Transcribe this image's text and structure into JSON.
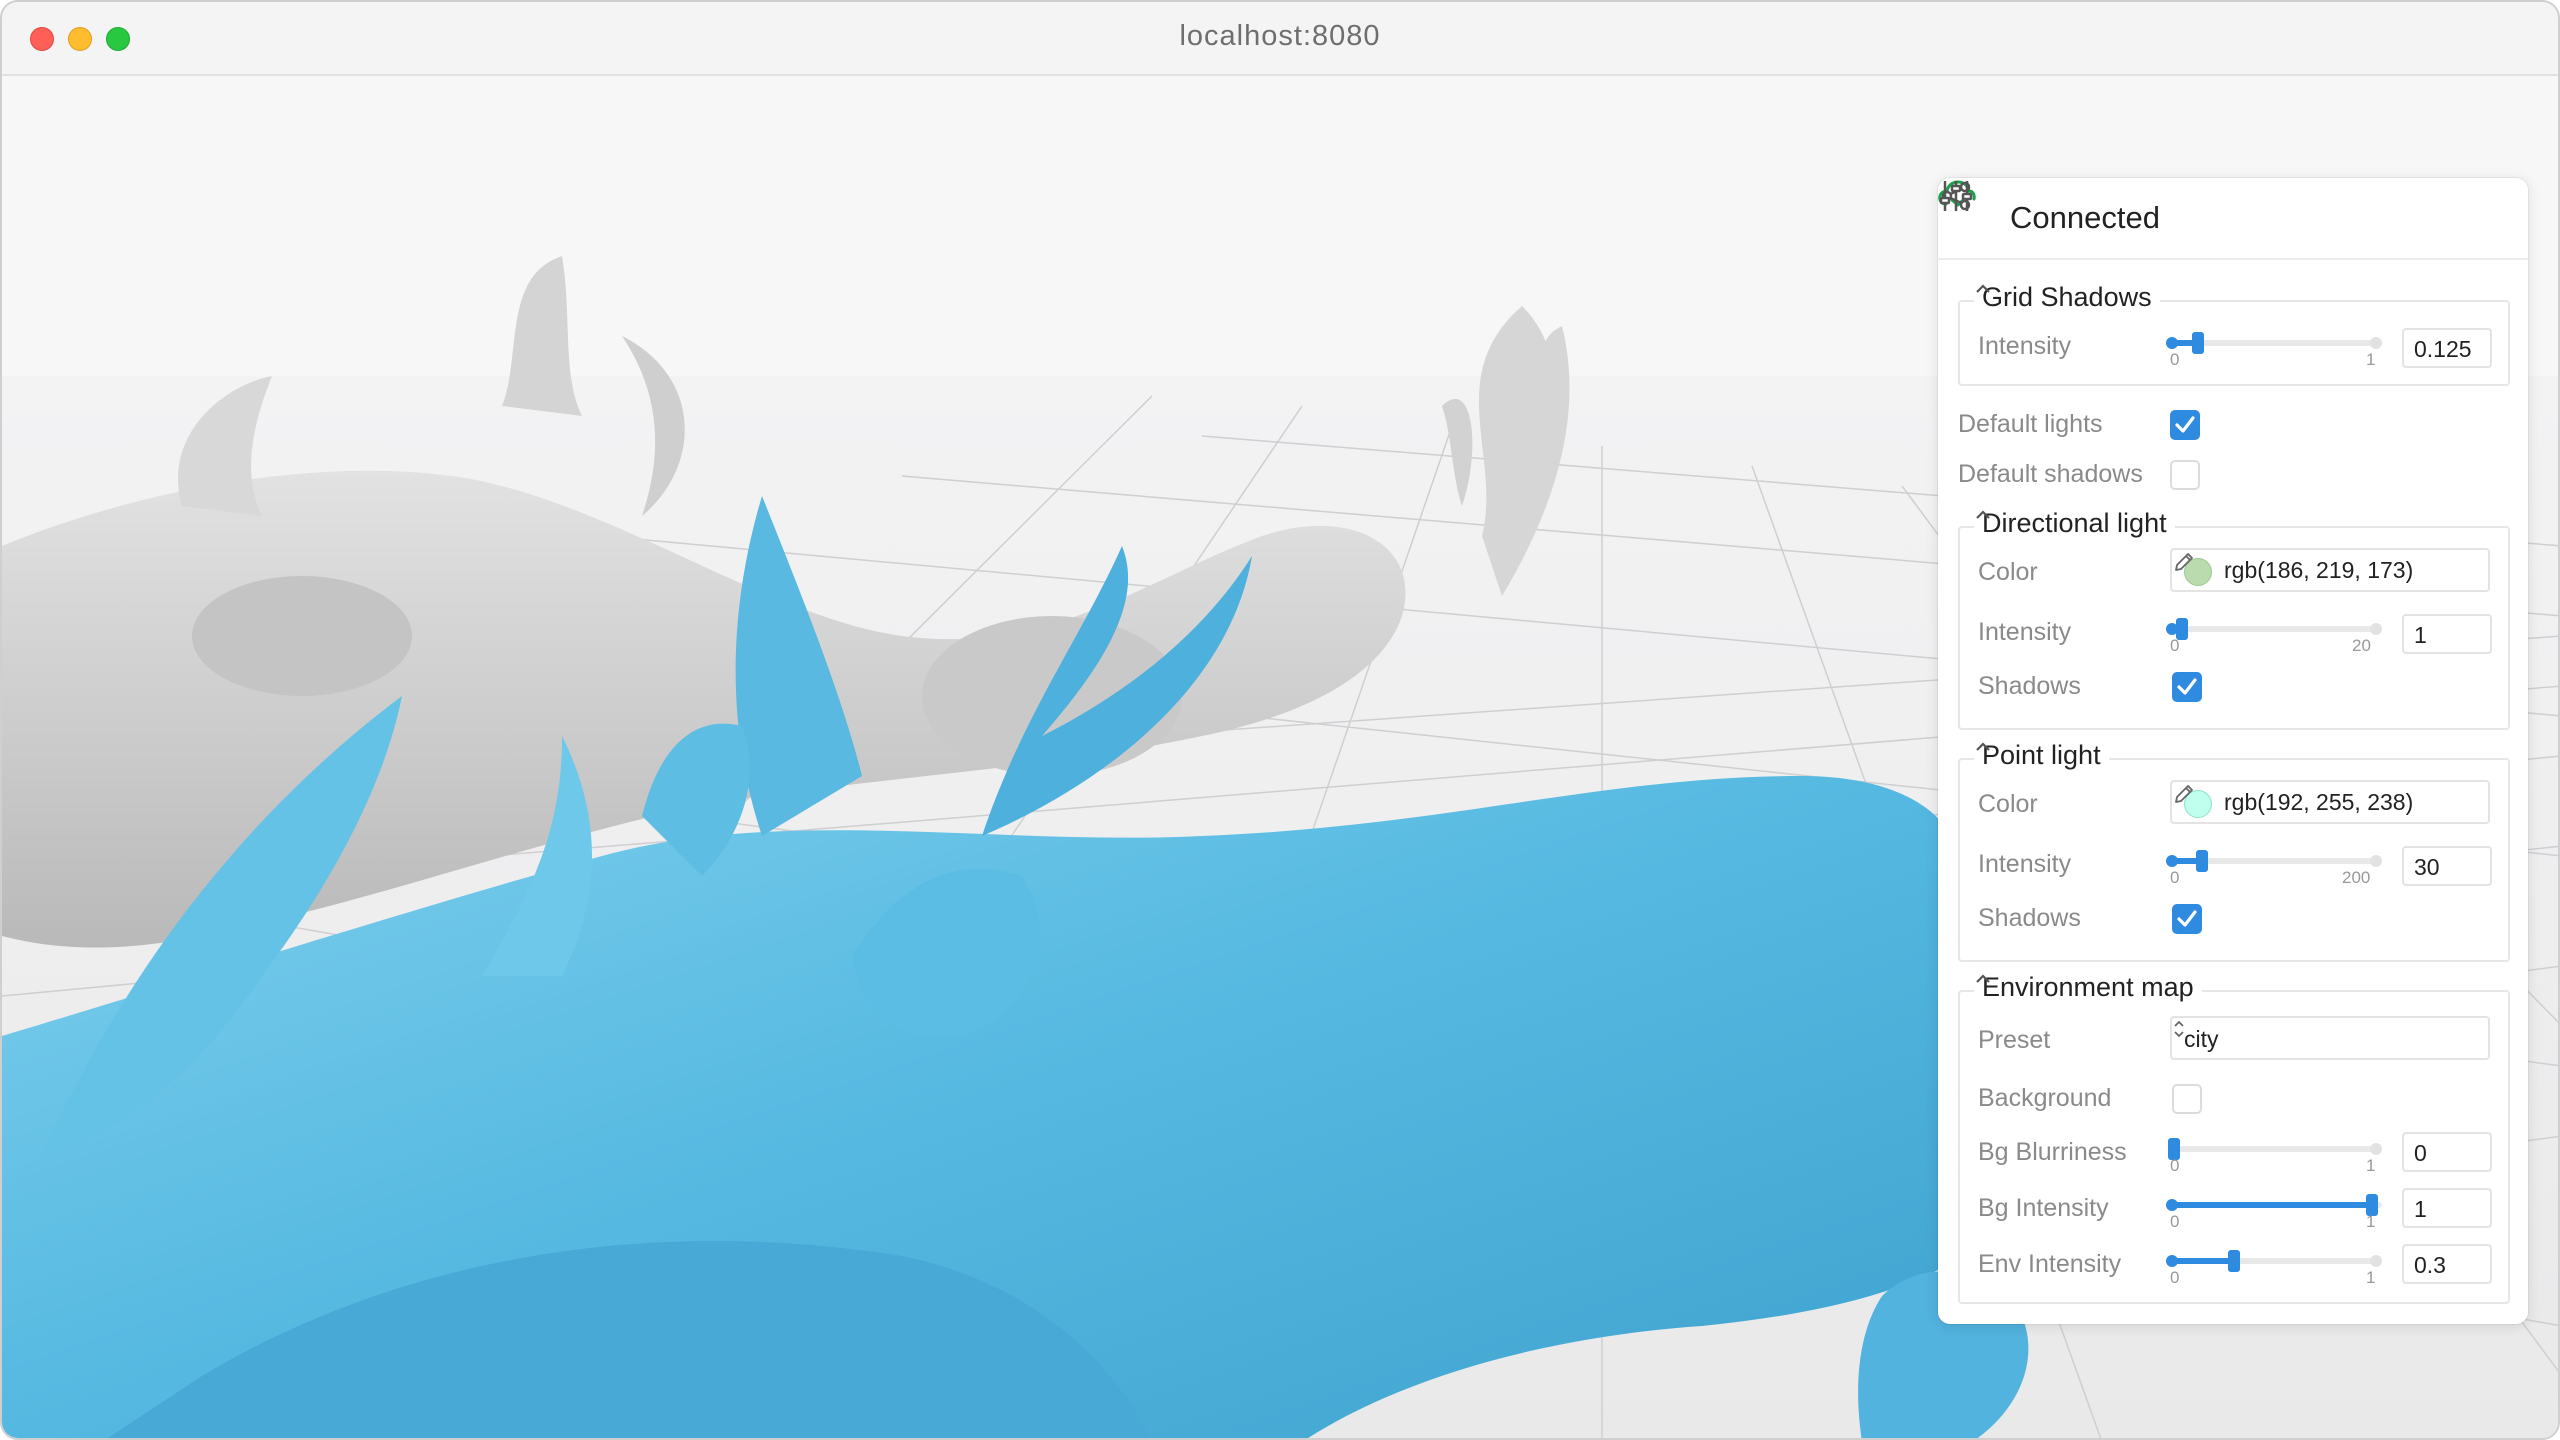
{
  "window": {
    "url": "localhost:8080"
  },
  "panel": {
    "status": "Connected",
    "grid_shadows": {
      "title": "Grid Shadows",
      "intensity": {
        "label": "Intensity",
        "min": "0",
        "max": "1",
        "value": "0.125",
        "fraction": 0.125
      }
    },
    "default_lights": {
      "label": "Default lights",
      "checked": true
    },
    "default_shadows": {
      "label": "Default shadows",
      "checked": false
    },
    "directional_light": {
      "title": "Directional light",
      "color": {
        "label": "Color",
        "value": "rgb(186, 219, 173)",
        "swatch": "#badbad"
      },
      "intensity": {
        "label": "Intensity",
        "min": "0",
        "max": "20",
        "value": "1",
        "fraction": 0.05
      },
      "shadows": {
        "label": "Shadows",
        "checked": true
      }
    },
    "point_light": {
      "title": "Point light",
      "color": {
        "label": "Color",
        "value": "rgb(192, 255, 238)",
        "swatch": "#c0ffee"
      },
      "intensity": {
        "label": "Intensity",
        "min": "0",
        "max": "200",
        "value": "30",
        "fraction": 0.15
      },
      "shadows": {
        "label": "Shadows",
        "checked": true
      }
    },
    "environment_map": {
      "title": "Environment map",
      "preset": {
        "label": "Preset",
        "value": "city"
      },
      "background": {
        "label": "Background",
        "checked": false
      },
      "bg_blurriness": {
        "label": "Bg Blurriness",
        "min": "0",
        "max": "1",
        "value": "0",
        "fraction": 0
      },
      "bg_intensity": {
        "label": "Bg Intensity",
        "min": "0",
        "max": "1",
        "value": "1",
        "fraction": 1
      },
      "env_intensity": {
        "label": "Env Intensity",
        "min": "0",
        "max": "1",
        "value": "0.3",
        "fraction": 0.3
      }
    }
  },
  "colors": {
    "accent": "#2f8be0",
    "connected": "#1aa34a",
    "model_blue": "#5bbde3",
    "model_grey": "#c8c8c8"
  }
}
